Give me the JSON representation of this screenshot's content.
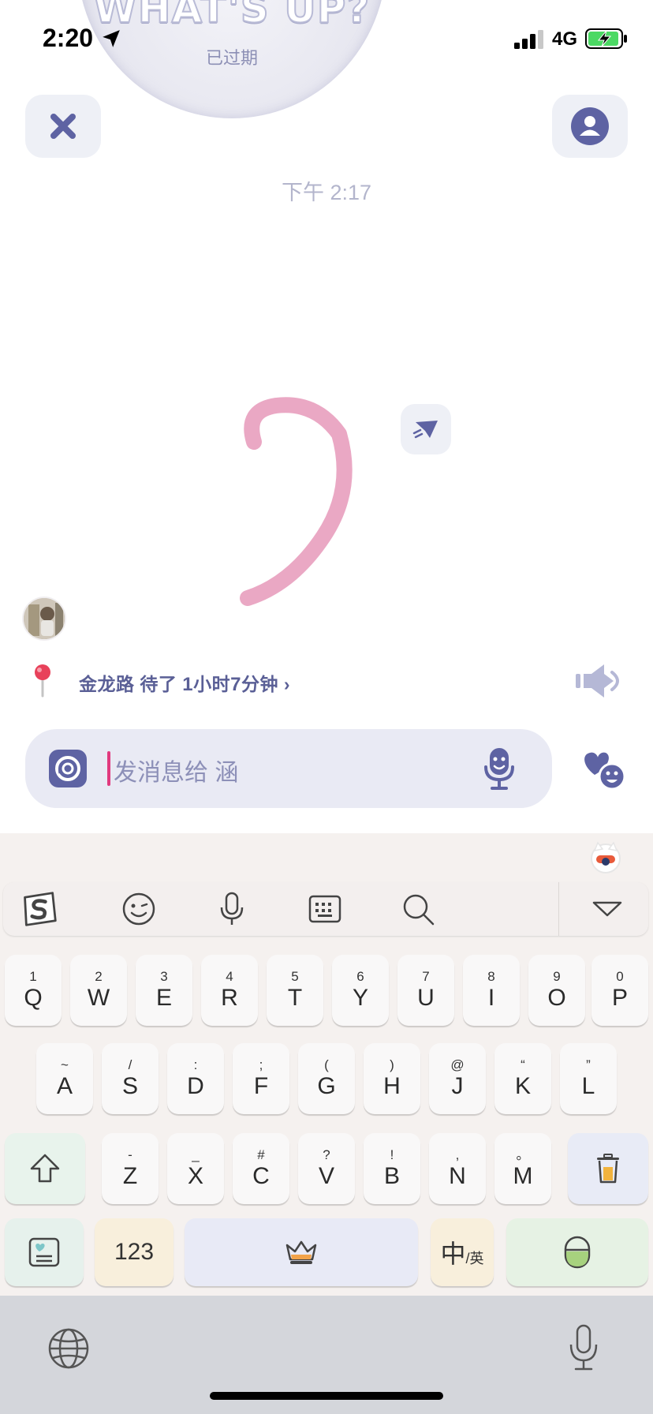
{
  "status": {
    "time": "2:20",
    "network": "4G",
    "signal_icon": "signal-bars-icon",
    "battery_icon": "battery-charging-icon"
  },
  "header": {
    "bubble_title": "WHAT'S UP?",
    "bubble_subtitle": "已过期"
  },
  "chat": {
    "timestamp": "下午 2:17"
  },
  "location": {
    "prefix": "金龙路 待了 ",
    "hours": "1",
    "mid": "小时",
    "minutes": "7",
    "suffix": "分钟 ›"
  },
  "input": {
    "placeholder": "发消息给 涵"
  },
  "keyboard": {
    "row1": [
      {
        "sym": "1",
        "key": "Q"
      },
      {
        "sym": "2",
        "key": "W"
      },
      {
        "sym": "3",
        "key": "E"
      },
      {
        "sym": "4",
        "key": "R"
      },
      {
        "sym": "5",
        "key": "T"
      },
      {
        "sym": "6",
        "key": "Y"
      },
      {
        "sym": "7",
        "key": "U"
      },
      {
        "sym": "8",
        "key": "I"
      },
      {
        "sym": "9",
        "key": "O"
      },
      {
        "sym": "0",
        "key": "P"
      }
    ],
    "row2": [
      {
        "sym": "~",
        "key": "A"
      },
      {
        "sym": "/",
        "key": "S"
      },
      {
        "sym": ":",
        "key": "D"
      },
      {
        "sym": ";",
        "key": "F"
      },
      {
        "sym": "(",
        "key": "G"
      },
      {
        "sym": ")",
        "key": "H"
      },
      {
        "sym": "@",
        "key": "J"
      },
      {
        "sym": "“",
        "key": "K"
      },
      {
        "sym": "”",
        "key": "L"
      }
    ],
    "row3": [
      {
        "sym": "-",
        "key": "Z"
      },
      {
        "sym": "_",
        "key": "X"
      },
      {
        "sym": "#",
        "key": "C"
      },
      {
        "sym": "?",
        "key": "V"
      },
      {
        "sym": "!",
        "key": "B"
      },
      {
        "sym": ",",
        "key": "N"
      },
      {
        "sym": "。",
        "key": "M"
      }
    ],
    "num_label": "123",
    "lang_label": "中",
    "lang_sub": "/英"
  },
  "colors": {
    "accent": "#5e63a3",
    "doodle": "#eaa8c4",
    "caret": "#e13a7e",
    "muted": "#b3b5cc"
  }
}
